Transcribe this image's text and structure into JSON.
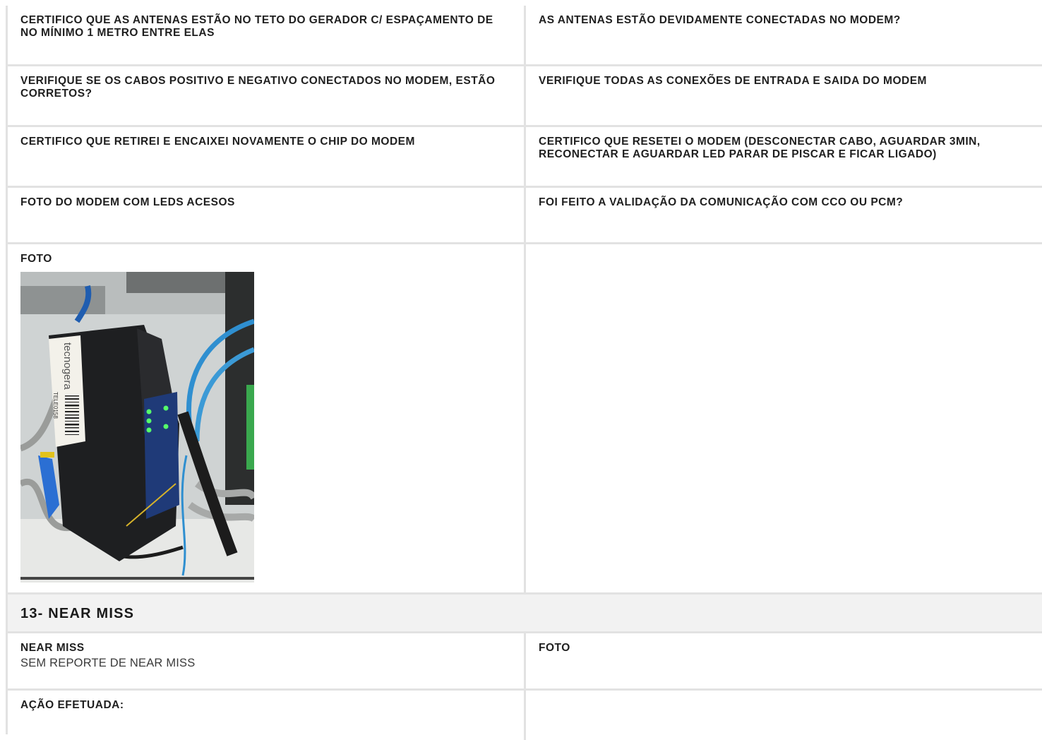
{
  "rows": [
    {
      "left": "CERTIFICO QUE AS ANTENAS ESTÃO NO TETO DO GERADOR C/ ESPAÇAMENTO DE NO MÍNIMO 1 METRO ENTRE ELAS",
      "right": "AS ANTENAS ESTÃO DEVIDAMENTE CONECTADAS NO MODEM?"
    },
    {
      "left": "VERIFIQUE SE OS CABOS POSITIVO E NEGATIVO CONECTADOS NO MODEM, ESTÃO CORRETOS?",
      "right": "VERIFIQUE TODAS AS CONEXÕES DE ENTRADA E SAIDA DO MODEM"
    },
    {
      "left": "CERTIFICO QUE RETIREI E ENCAIXEI NOVAMENTE O CHIP DO MODEM",
      "right": "CERTIFICO QUE RESETEI O MODEM (DESCONECTAR CABO, AGUARDAR 3MIN, RECONECTAR E AGUARDAR LED PARAR DE PISCAR E FICAR LIGADO)"
    },
    {
      "left": "FOTO DO MODEM COM LEDS ACESOS",
      "right": "FOI FEITO A VALIDAÇÃO DA COMUNICAÇÃO COM CCO OU PCM?"
    },
    {
      "left": "FOTO",
      "right": ""
    }
  ],
  "photo": {
    "brand": "tecnogera",
    "serial": "TELE0158"
  },
  "section": {
    "title": "13- NEAR MISS"
  },
  "near_miss": {
    "label": "NEAR MISS",
    "value": "SEM REPORTE DE NEAR MISS",
    "foto_label": "FOTO"
  },
  "acao": {
    "label": "AÇÃO EFETUADA:"
  }
}
